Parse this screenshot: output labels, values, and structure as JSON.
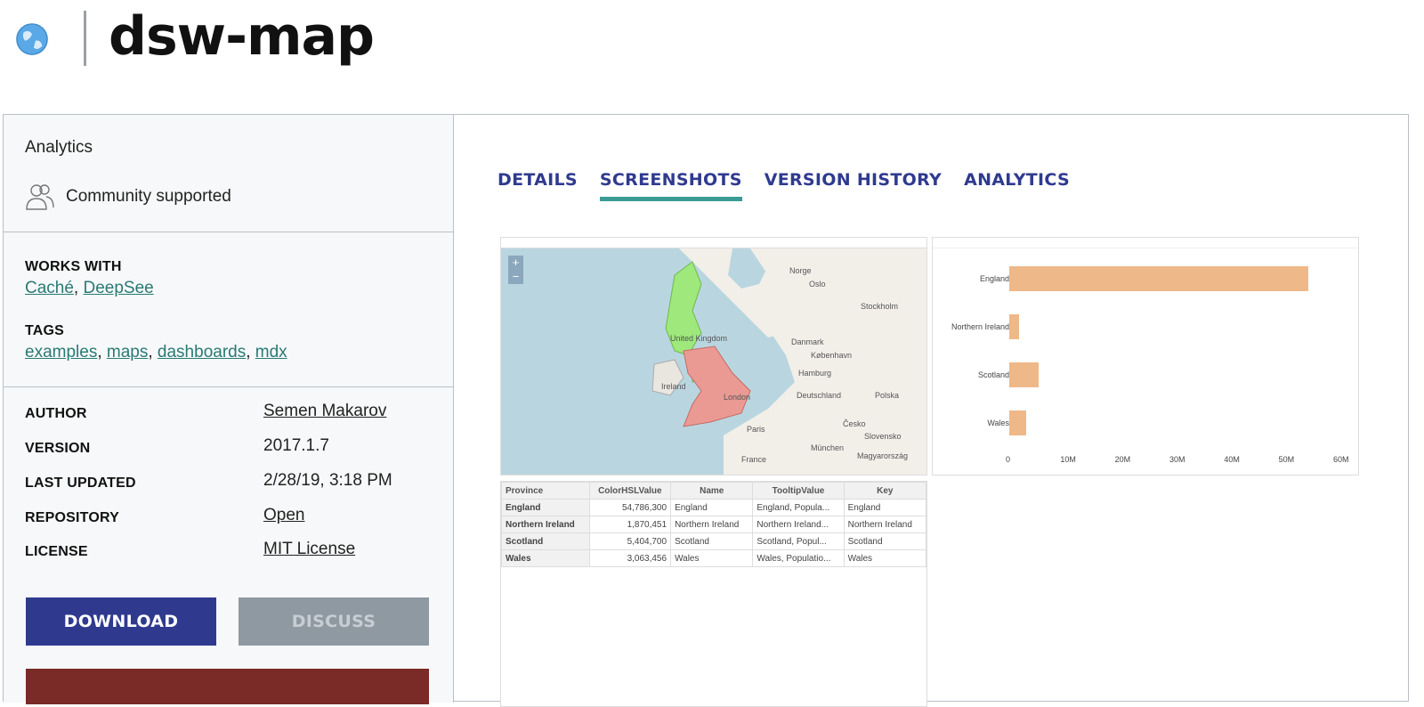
{
  "header": {
    "title": "dsw-map",
    "logo_icon": "globe-icon"
  },
  "sidebar": {
    "category": "Analytics",
    "support_icon": "people-icon",
    "support": "Community supported",
    "works_with_label": "WORKS WITH",
    "works_with": [
      "Caché",
      "DeepSee"
    ],
    "tags_label": "TAGS",
    "tags": [
      "examples",
      "maps",
      "dashboards",
      "mdx"
    ],
    "meta": {
      "author_label": "AUTHOR",
      "author": "Semen Makarov",
      "version_label": "VERSION",
      "version": "2017.1.7",
      "updated_label": "LAST UPDATED",
      "updated": "2/28/19, 3:18 PM",
      "repo_label": "REPOSITORY",
      "repo": "Open",
      "license_label": "LICENSE",
      "license": "MIT License"
    },
    "download_label": "DOWNLOAD",
    "discuss_label": "DISCUSS"
  },
  "tabs": [
    {
      "label": "DETAILS",
      "active": false
    },
    {
      "label": "SCREENSHOTS",
      "active": true
    },
    {
      "label": "VERSION HISTORY",
      "active": false
    },
    {
      "label": "ANALYTICS",
      "active": false
    }
  ],
  "map": {
    "zoom_in": "+",
    "zoom_out": "−",
    "labels": [
      "Norge",
      "Oslo",
      "Stockholm",
      "Danmark",
      "København",
      "United Kingdom",
      "Hamburg",
      "Ireland",
      "London",
      "Deutschland",
      "Polska",
      "Paris",
      "Česko",
      "München",
      "Slovensko",
      "France",
      "Magyarország"
    ]
  },
  "chart_data": {
    "type": "bar",
    "orientation": "horizontal",
    "categories": [
      "England",
      "Northern Ireland",
      "Scotland",
      "Wales"
    ],
    "values": [
      54786300,
      1870451,
      5404700,
      3063456
    ],
    "xlim": [
      0,
      60000000
    ],
    "xticks": [
      "0",
      "10M",
      "20M",
      "30M",
      "40M",
      "50M",
      "60M"
    ],
    "color": "#efb888"
  },
  "table": {
    "headers": [
      "Province",
      "ColorHSLValue",
      "Name",
      "TooltipValue",
      "Key"
    ],
    "rows": [
      [
        "England",
        "54,786,300",
        "England",
        "England, Popula...",
        "England"
      ],
      [
        "Northern Ireland",
        "1,870,451",
        "Northern Ireland",
        "Northern Ireland...",
        "Northern Ireland"
      ],
      [
        "Scotland",
        "5,404,700",
        "Scotland",
        "Scotland, Popul...",
        "Scotland"
      ],
      [
        "Wales",
        "3,063,456",
        "Wales",
        "Wales, Populatio...",
        "Wales"
      ]
    ]
  }
}
